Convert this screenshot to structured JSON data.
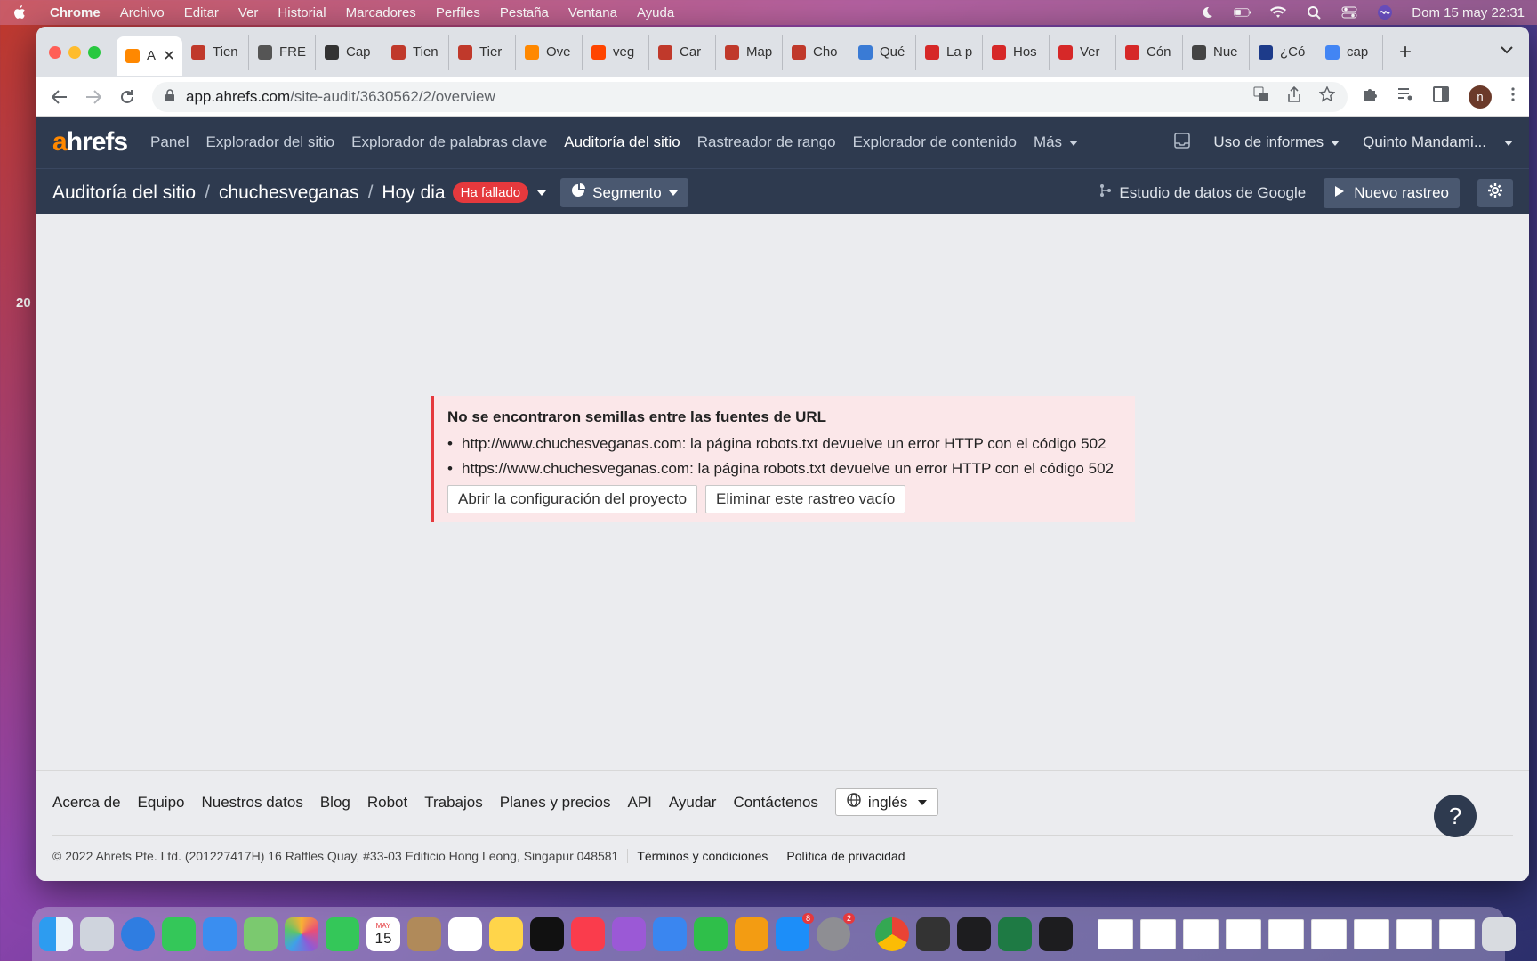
{
  "menubar": {
    "app": "Chrome",
    "items": [
      "Archivo",
      "Editar",
      "Ver",
      "Historial",
      "Marcadores",
      "Perfiles",
      "Pestaña",
      "Ventana",
      "Ayuda"
    ],
    "datetime": "Dom 15 may  22:31"
  },
  "desktop_text": "20",
  "tabs": [
    {
      "label": "A",
      "favicon": "ahrefs-icon",
      "color": "#ff8800"
    },
    {
      "label": "Tien",
      "favicon": "face-icon",
      "color": "#c0392b"
    },
    {
      "label": "FRE",
      "favicon": "fifty-icon",
      "color": "#555"
    },
    {
      "label": "Cap",
      "favicon": "globe-icon",
      "color": "#333"
    },
    {
      "label": "Tien",
      "favicon": "face-icon",
      "color": "#c0392b"
    },
    {
      "label": "Tier",
      "favicon": "face-icon",
      "color": "#c0392b"
    },
    {
      "label": "Ove",
      "favicon": "ahrefs-icon",
      "color": "#ff8800"
    },
    {
      "label": "veg",
      "favicon": "semrush-icon",
      "color": "#ff4500"
    },
    {
      "label": "Car",
      "favicon": "face-icon",
      "color": "#c0392b"
    },
    {
      "label": "Map",
      "favicon": "face-icon",
      "color": "#c0392b"
    },
    {
      "label": "Cho",
      "favicon": "face-icon",
      "color": "#c0392b"
    },
    {
      "label": "Qué",
      "favicon": "cube-icon",
      "color": "#3a7bd5"
    },
    {
      "label": "La p",
      "favicon": "w-icon",
      "color": "#d62828"
    },
    {
      "label": "Hos",
      "favicon": "w-icon",
      "color": "#d62828"
    },
    {
      "label": "Ver",
      "favicon": "w-icon",
      "color": "#d62828"
    },
    {
      "label": "Cón",
      "favicon": "w-icon",
      "color": "#d62828"
    },
    {
      "label": "Nue",
      "favicon": "chrome-gear-icon",
      "color": "#444"
    },
    {
      "label": "¿Có",
      "favicon": "flag-icon",
      "color": "#1d3b8a"
    },
    {
      "label": "cap",
      "favicon": "google-icon",
      "color": "#4285f4"
    }
  ],
  "address": {
    "host": "app.ahrefs.com",
    "path": "/site-audit/3630562/2/overview"
  },
  "profile_initial": "n",
  "ahrefs": {
    "logo_a": "a",
    "logo_rest": "hrefs",
    "nav": [
      "Panel",
      "Explorador del sitio",
      "Explorador de palabras clave",
      "Auditoría del sitio",
      "Rastreador de rango",
      "Explorador de contenido",
      "Más"
    ],
    "usage": "Uso de informes",
    "account": "Quinto Mandami..."
  },
  "subheader": {
    "crumb1": "Auditoría del sitio",
    "crumb2": "chuchesveganas",
    "crumb3": "Hoy dia",
    "status_badge": "Ha fallado",
    "segment": "Segmento",
    "gds": "Estudio de datos de Google",
    "new_crawl": "Nuevo rastreo"
  },
  "alert": {
    "title": "No se encontraron semillas entre las fuentes de URL",
    "errors": [
      "http://www.chuchesveganas.com: la página robots.txt devuelve un error HTTP con el código 502",
      "https://www.chuchesveganas.com: la página robots.txt devuelve un error HTTP con el código 502"
    ],
    "btn_config": "Abrir la configuración del proyecto",
    "btn_delete": "Eliminar este rastreo vacío"
  },
  "footer": {
    "links": [
      "Acerca de",
      "Equipo",
      "Nuestros datos",
      "Blog",
      "Robot",
      "Trabajos",
      "Planes y precios",
      "API",
      "Ayudar",
      "Contáctenos"
    ],
    "language": "inglés",
    "copyright": "© 2022 Ahrefs Pte. Ltd. (201227417H) 16 Raffles Quay, #33-03 Edificio Hong Leong, Singapur 048581",
    "terms": "Términos y condiciones",
    "privacy": "Política de privacidad",
    "help": "?"
  },
  "dock": {
    "calendar_month": "MAY",
    "calendar_day": "15",
    "appstore_badge": "8",
    "settings_badge": "2"
  },
  "colors": {
    "ahrefs_header": "#2e3a4f",
    "accent_orange": "#ff8800",
    "error_red": "#e5393d",
    "alert_bg": "#fbe7e9"
  }
}
